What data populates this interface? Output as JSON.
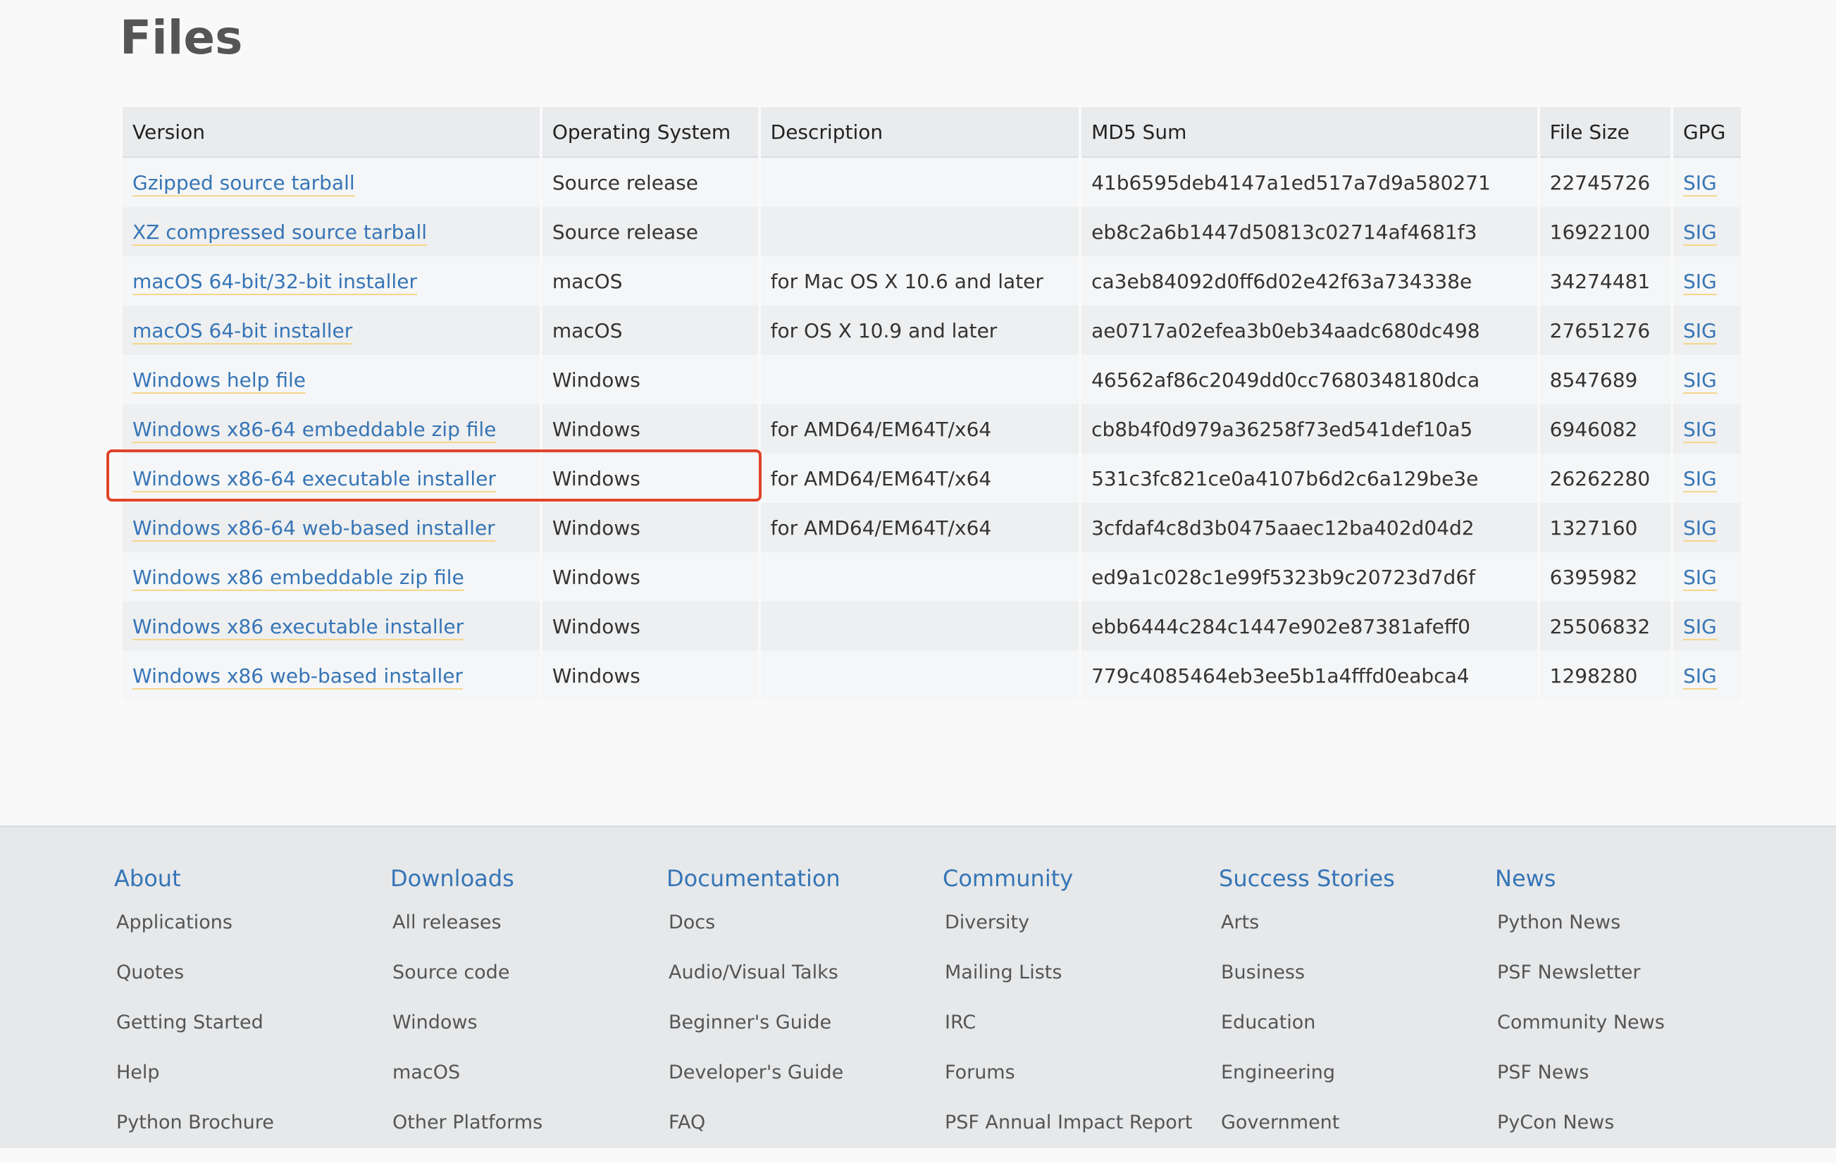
{
  "page": {
    "title": "Files"
  },
  "table": {
    "headers": [
      "Version",
      "Operating System",
      "Description",
      "MD5 Sum",
      "File Size",
      "GPG"
    ],
    "rows": [
      {
        "version": "Gzipped source tarball",
        "os": "Source release",
        "description": "",
        "md5": "41b6595deb4147a1ed517a7d9a580271",
        "size": "22745726",
        "gpg": "SIG"
      },
      {
        "version": "XZ compressed source tarball",
        "os": "Source release",
        "description": "",
        "md5": "eb8c2a6b1447d50813c02714af4681f3",
        "size": "16922100",
        "gpg": "SIG"
      },
      {
        "version": "macOS 64-bit/32-bit installer",
        "os": "macOS",
        "description": "for Mac OS X 10.6 and later",
        "md5": "ca3eb84092d0ff6d02e42f63a734338e",
        "size": "34274481",
        "gpg": "SIG"
      },
      {
        "version": "macOS 64-bit installer",
        "os": "macOS",
        "description": "for OS X 10.9 and later",
        "md5": "ae0717a02efea3b0eb34aadc680dc498",
        "size": "27651276",
        "gpg": "SIG"
      },
      {
        "version": "Windows help file",
        "os": "Windows",
        "description": "",
        "md5": "46562af86c2049dd0cc7680348180dca",
        "size": "8547689",
        "gpg": "SIG"
      },
      {
        "version": "Windows x86-64 embeddable zip file",
        "os": "Windows",
        "description": "for AMD64/EM64T/x64",
        "md5": "cb8b4f0d979a36258f73ed541def10a5",
        "size": "6946082",
        "gpg": "SIG"
      },
      {
        "version": "Windows x86-64 executable installer",
        "os": "Windows",
        "description": "for AMD64/EM64T/x64",
        "md5": "531c3fc821ce0a4107b6d2c6a129be3e",
        "size": "26262280",
        "gpg": "SIG"
      },
      {
        "version": "Windows x86-64 web-based installer",
        "os": "Windows",
        "description": "for AMD64/EM64T/x64",
        "md5": "3cfdaf4c8d3b0475aaec12ba402d04d2",
        "size": "1327160",
        "gpg": "SIG"
      },
      {
        "version": "Windows x86 embeddable zip file",
        "os": "Windows",
        "description": "",
        "md5": "ed9a1c028c1e99f5323b9c20723d7d6f",
        "size": "6395982",
        "gpg": "SIG"
      },
      {
        "version": "Windows x86 executable installer",
        "os": "Windows",
        "description": "",
        "md5": "ebb6444c284c1447e902e87381afeff0",
        "size": "25506832",
        "gpg": "SIG"
      },
      {
        "version": "Windows x86 web-based installer",
        "os": "Windows",
        "description": "",
        "md5": "779c4085464eb3ee5b1a4fffd0eabca4",
        "size": "1298280",
        "gpg": "SIG"
      }
    ],
    "highlighted_row": "Windows x86-64 executable installer"
  },
  "footer": {
    "columns": [
      {
        "heading": "About",
        "items": [
          "Applications",
          "Quotes",
          "Getting Started",
          "Help",
          "Python Brochure"
        ]
      },
      {
        "heading": "Downloads",
        "items": [
          "All releases",
          "Source code",
          "Windows",
          "macOS",
          "Other Platforms"
        ]
      },
      {
        "heading": "Documentation",
        "items": [
          "Docs",
          "Audio/Visual Talks",
          "Beginner's Guide",
          "Developer's Guide",
          "FAQ"
        ]
      },
      {
        "heading": "Community",
        "items": [
          "Diversity",
          "Mailing Lists",
          "IRC",
          "Forums",
          "PSF Annual Impact Report"
        ]
      },
      {
        "heading": "Success Stories",
        "items": [
          "Arts",
          "Business",
          "Education",
          "Engineering",
          "Government"
        ]
      },
      {
        "heading": "News",
        "items": [
          "Python News",
          "PSF Newsletter",
          "Community News",
          "PSF News",
          "PyCon News"
        ]
      }
    ]
  },
  "colors": {
    "link": "#3675b6",
    "highlight_border": "#e0442b",
    "title": "#555555",
    "footer_bg": "#e6e8ea"
  }
}
